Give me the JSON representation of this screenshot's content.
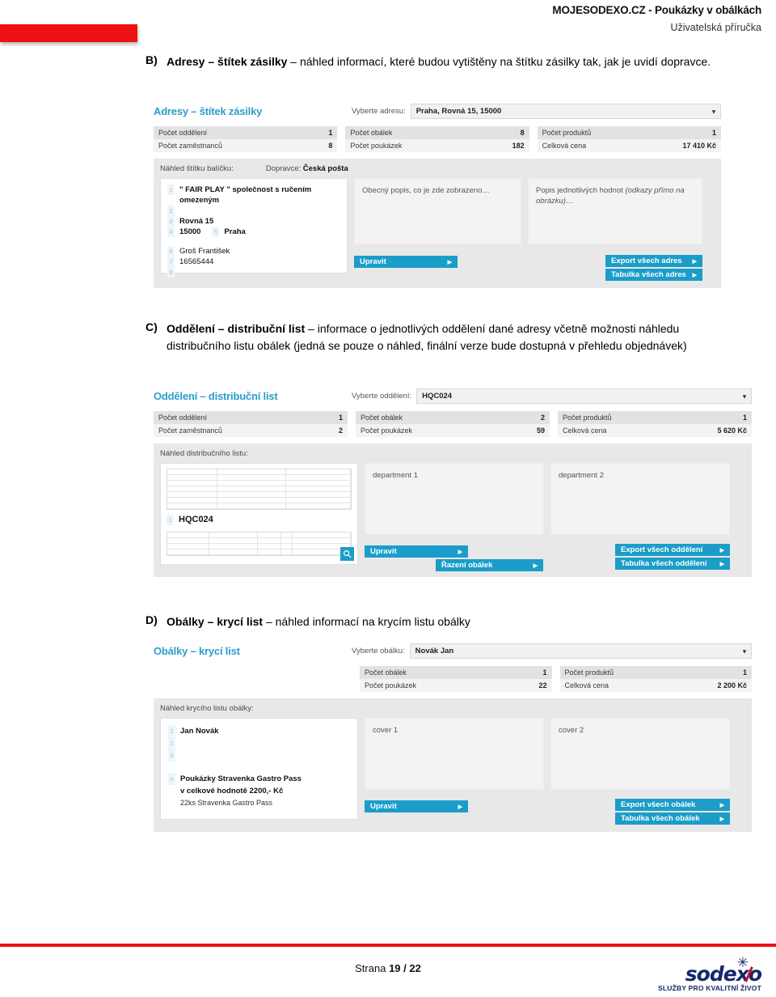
{
  "header": {
    "line1": "MOJESODEXO.CZ - Poukázky v obálkách",
    "line2": "Uživatelská příručka"
  },
  "sections": [
    {
      "letter": "B)",
      "bold": "Adresy – štítek zásilky",
      "rest": " – náhled informací, které budou vytištěny na štítku zásilky tak, jak je uvidí dopravce."
    },
    {
      "letter": "C)",
      "bold": "Oddělení – distribuční list",
      "rest": " – informace o jednotlivých oddělení dané adresy včetně možnosti náhledu distribučního listu obálek (jedná se pouze o náhled, finální verze bude dostupná v přehledu objednávek)"
    },
    {
      "letter": "D)",
      "bold": "Obálky – krycí list",
      "rest": " – náhled informací na krycím listu obálky"
    }
  ],
  "shot_b": {
    "title": "Adresy – štítek zásilky",
    "select_label": "Vyberte adresu:",
    "select_value": "Praha, Rovná 15, 15000",
    "caret": "▾",
    "stats": [
      [
        {
          "label": "Počet oddělení",
          "value": "1"
        },
        {
          "label": "Počet zaměstnanců",
          "value": "8"
        }
      ],
      [
        {
          "label": "Počet obálek",
          "value": "8"
        },
        {
          "label": "Počet poukázek",
          "value": "182"
        }
      ],
      [
        {
          "label": "Počet produktů",
          "value": "1"
        },
        {
          "label": "Celková cena",
          "value": "17 410 Kč"
        }
      ]
    ],
    "preview_label": "Náhled štítku balíčku:",
    "carrier_label": "Dopravce:",
    "carrier_value": "Česká pošta",
    "lines": [
      {
        "num": "1",
        "text": "\" FAIR PLAY \" společnost s ručením omezeným",
        "bold": true
      },
      {
        "num": "2",
        "text": "",
        "bold": false
      },
      {
        "num": "3",
        "text": "Rovná 15",
        "bold": true
      },
      {
        "num": "4",
        "text": "15000",
        "bold": true,
        "num2": "5",
        "text2": "Praha"
      },
      {
        "num": "",
        "text": "",
        "bold": false
      },
      {
        "num": "6",
        "text": "Groš František",
        "bold": false
      },
      {
        "num": "7",
        "text": "16565444",
        "bold": false
      },
      {
        "num": "8",
        "text": "",
        "bold": false
      }
    ],
    "note_mid": "Obecný popis, co je zde zobrazeno…",
    "note_right_plain": "Popis jednotlivých hodnot ",
    "note_right_italic": "(odkazy přímo na obrázku)…",
    "btn_edit": "Upravit",
    "btn_export": "Export všech adres",
    "btn_table": "Tabulka všech adres",
    "arrow": "▶"
  },
  "shot_c": {
    "title": "Oddělení – distribuční list",
    "select_label": "Vyberte oddělení:",
    "select_value": "HQC024",
    "caret": "▾",
    "stats": [
      [
        {
          "label": "Počet oddělení",
          "value": "1"
        },
        {
          "label": "Počet zaměstnanců",
          "value": "2"
        }
      ],
      [
        {
          "label": "Počet obálek",
          "value": "2"
        },
        {
          "label": "Počet poukázek",
          "value": "59"
        }
      ],
      [
        {
          "label": "Počet produktů",
          "value": "1"
        },
        {
          "label": "Celková cena",
          "value": "5 620 Kč"
        }
      ]
    ],
    "preview_label": "Náhled distribučního listu:",
    "doc_code_num": "1",
    "doc_code": "HQC024",
    "note_mid": "department 1",
    "note_right": "department 2",
    "btn_edit": "Upravit",
    "btn_sort": "Řazení obálek",
    "btn_export": "Export všech oddělení",
    "btn_table": "Tabulka všech oddělení",
    "arrow": "▶",
    "magnifier": "search-icon"
  },
  "shot_d": {
    "title": "Obálky – krycí list",
    "select_label": "Vyberte obálku:",
    "select_value": "Novák Jan",
    "caret": "▾",
    "stats": [
      [
        {
          "label": "Počet obálek",
          "value": "1"
        },
        {
          "label": "Počet poukázek",
          "value": "22"
        }
      ],
      [
        {
          "label": "Počet produktů",
          "value": "1"
        },
        {
          "label": "Celková cena",
          "value": "2 200 Kč"
        }
      ]
    ],
    "preview_label": "Náhled krycího listu obálky:",
    "lines": [
      {
        "num": "1",
        "text": "Jan Novák",
        "bold": true
      },
      {
        "num": "2",
        "text": "",
        "bold": false
      },
      {
        "num": "3",
        "text": "",
        "bold": false
      },
      {
        "num": "",
        "text": "",
        "bold": false
      },
      {
        "num": "4",
        "text": "Poukázky Stravenka Gastro Pass",
        "bold": true
      },
      {
        "num": "",
        "text": "v celkové hodnotě 2200,- Kč",
        "bold": true
      },
      {
        "num": "",
        "text": "22ks Stravenka Gastro Pass",
        "bold": false
      }
    ],
    "note_mid": "cover 1",
    "note_right": "cover 2",
    "btn_edit": "Upravit",
    "btn_export": "Export všech obálek",
    "btn_table": "Tabulka všech obálek",
    "arrow": "▶"
  },
  "footer": {
    "page_prefix": "Strana ",
    "page_current": "19",
    "page_sep": " / ",
    "page_total": "22",
    "logo_word": "sodexo",
    "logo_tagline": "SLUŽBY PRO KVALITNÍ ŽIVOT"
  },
  "colors": {
    "accent_blue": "#1b9dc9",
    "title_blue": "#2b9dc9",
    "brand_red": "#ee1111",
    "logo_navy": "#16286b"
  }
}
